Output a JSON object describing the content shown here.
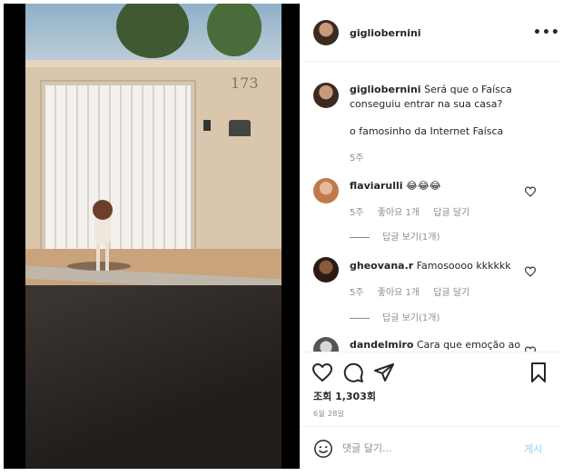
{
  "post": {
    "author": "gigliobernini",
    "caption": "Será que o Faísca conseguiu entrar na sua casa?",
    "caption_line2": "o famosinho da Internet Faísca",
    "caption_time": "5주",
    "views": "조회 1,303회",
    "date": "6월 28일",
    "more_label": "•••"
  },
  "comments": [
    {
      "username": "flaviarulli",
      "text": "😂😂😂",
      "time": "5주",
      "likes": "좋아요 1개",
      "reply": "답글 달기",
      "view_replies": "답글 보기(1개)"
    },
    {
      "username": "gheovana.r",
      "text": "Famosoooo kkkkkk",
      "time": "5주",
      "likes": "좋아요 1개",
      "reply": "답글 달기",
      "view_replies": "답글 보기(1개)"
    },
    {
      "username": "dandelmiro",
      "text": "Cara que emoção ao"
    }
  ],
  "video_scene": {
    "house_number": "173"
  },
  "composer": {
    "placeholder": "댓글 달기...",
    "post_label": "게시"
  },
  "icons": {
    "like": "heart-icon",
    "comment": "comment-icon",
    "share": "paper-plane-icon",
    "save": "bookmark-icon",
    "emoji": "emoji-icon",
    "more": "more-options-icon"
  },
  "colors": {
    "text": "#262626",
    "muted": "#8e8e8e",
    "border": "#dbdbdb",
    "post_disabled": "#b2dffc"
  }
}
